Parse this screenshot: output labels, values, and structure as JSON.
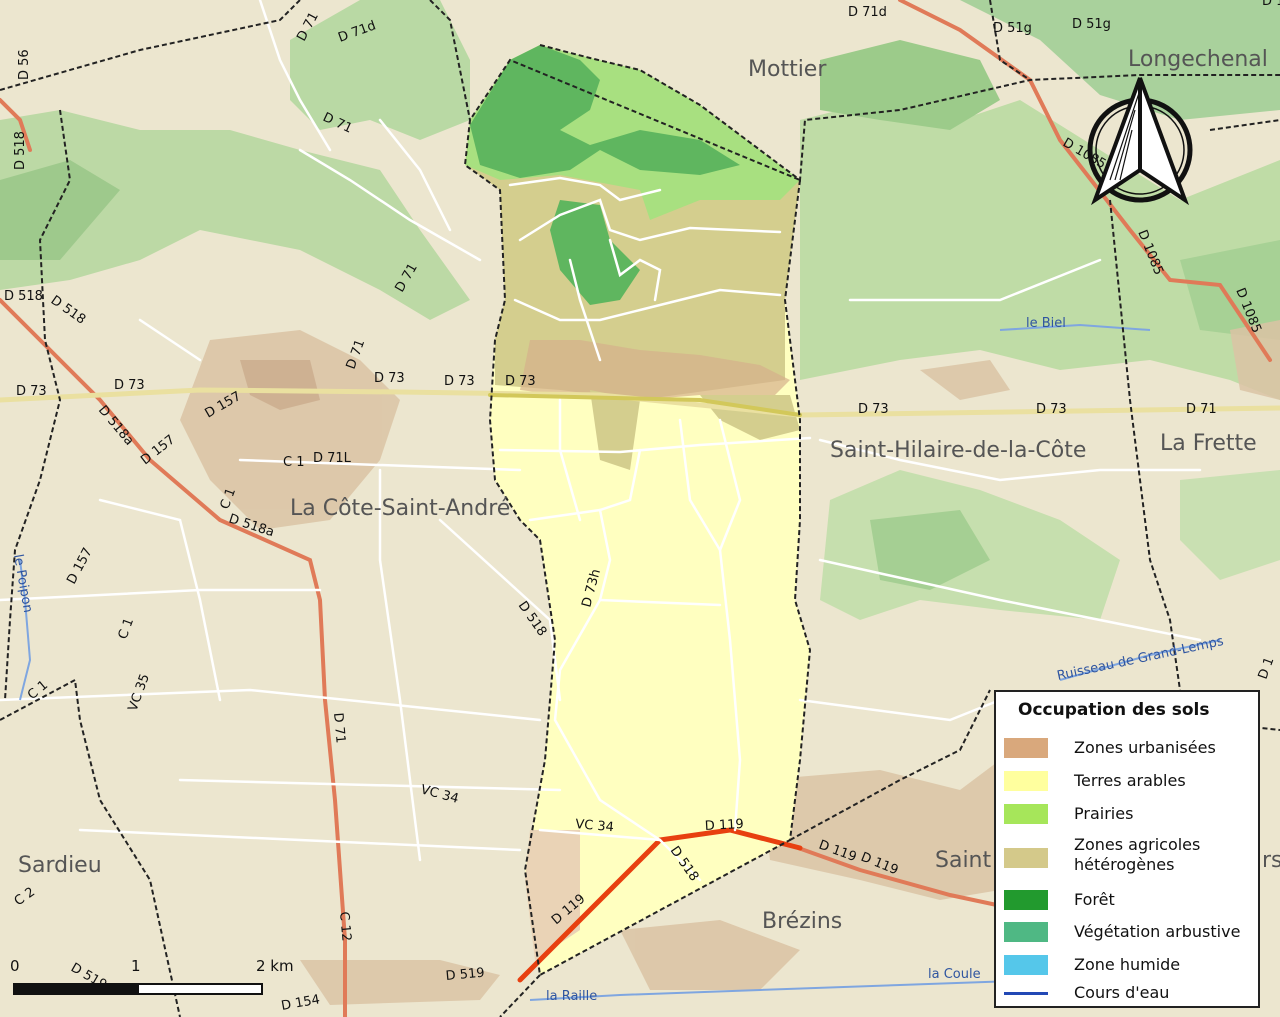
{
  "colors": {
    "background": "#ece6cf",
    "forest_outside": "#a8cf98",
    "commune_arable": "#ffffc0",
    "commune_hetero": "#d4ce8e",
    "commune_prairies": "#a8e080",
    "commune_forest": "#5fb65f",
    "urban": "#d6b08c",
    "road_major": "#e07a58",
    "road_d119": "#e84010",
    "road_minor": "#ffffff",
    "water": "#3b6fd0"
  },
  "places": [
    {
      "id": "mottier",
      "text": "Mottier"
    },
    {
      "id": "longechenal",
      "text": "Longechenal"
    },
    {
      "id": "st-hilaire",
      "text": "Saint-Hilaire-de-la-Côte"
    },
    {
      "id": "la-frette",
      "text": "La Frette"
    },
    {
      "id": "la-cote",
      "text": "La Côte-Saint-André"
    },
    {
      "id": "sardieu",
      "text": "Sardieu"
    },
    {
      "id": "saint-partial",
      "text": "Saint"
    },
    {
      "id": "brezins",
      "text": "Brézins"
    },
    {
      "id": "rs-partial",
      "text": "rs"
    }
  ],
  "roads": [
    "D 71",
    "D 71d",
    "D 56",
    "D 518",
    "D 71d",
    "D 51g",
    "D 51g",
    "D 1085",
    "D 1085",
    "D 1085",
    "D 71",
    "D 71",
    "D 71",
    "D 518",
    "D 518",
    "D 73",
    "D 73",
    "D 73",
    "D 73",
    "D 73",
    "D 73",
    "D 73",
    "D 157",
    "D 518a",
    "D 157",
    "C 1",
    "D 71L",
    "C 1",
    "D 518a",
    "D 157",
    "D 73h",
    "D 518",
    "C 1",
    "VC 35",
    "C 1",
    "D 71",
    "VC 34",
    "VC 34",
    "D 119",
    "D 518",
    "D 119",
    "D 119",
    "D 119",
    "D 119",
    "D 71",
    "C 12",
    "C 2",
    "D 519",
    "D 519",
    "D 154",
    "D 1"
  ],
  "water_labels": [
    "le Poipon",
    "le Biel",
    "Ruisseau de Grand-Lemps",
    "la Raille",
    "la Coule"
  ],
  "legend": {
    "title": "Occupation des sols",
    "items": [
      {
        "label": "Zones urbanisées",
        "color": "#d9a87c"
      },
      {
        "label": "Terres arables",
        "color": "#ffff9e"
      },
      {
        "label": "Prairies",
        "color": "#a6e65a"
      },
      {
        "label": "Zones agricoles\nhétérogènes",
        "color": "#d4c98a"
      },
      {
        "label": "Forêt",
        "color": "#229a2e"
      },
      {
        "label": "Végétation arbustive",
        "color": "#4fb884"
      },
      {
        "label": "Zone humide",
        "color": "#55c7ea"
      },
      {
        "label": "Cours d'eau",
        "color": "#2248b5"
      }
    ]
  },
  "scale": {
    "ticks": [
      "0",
      "1",
      "2 km"
    ]
  }
}
